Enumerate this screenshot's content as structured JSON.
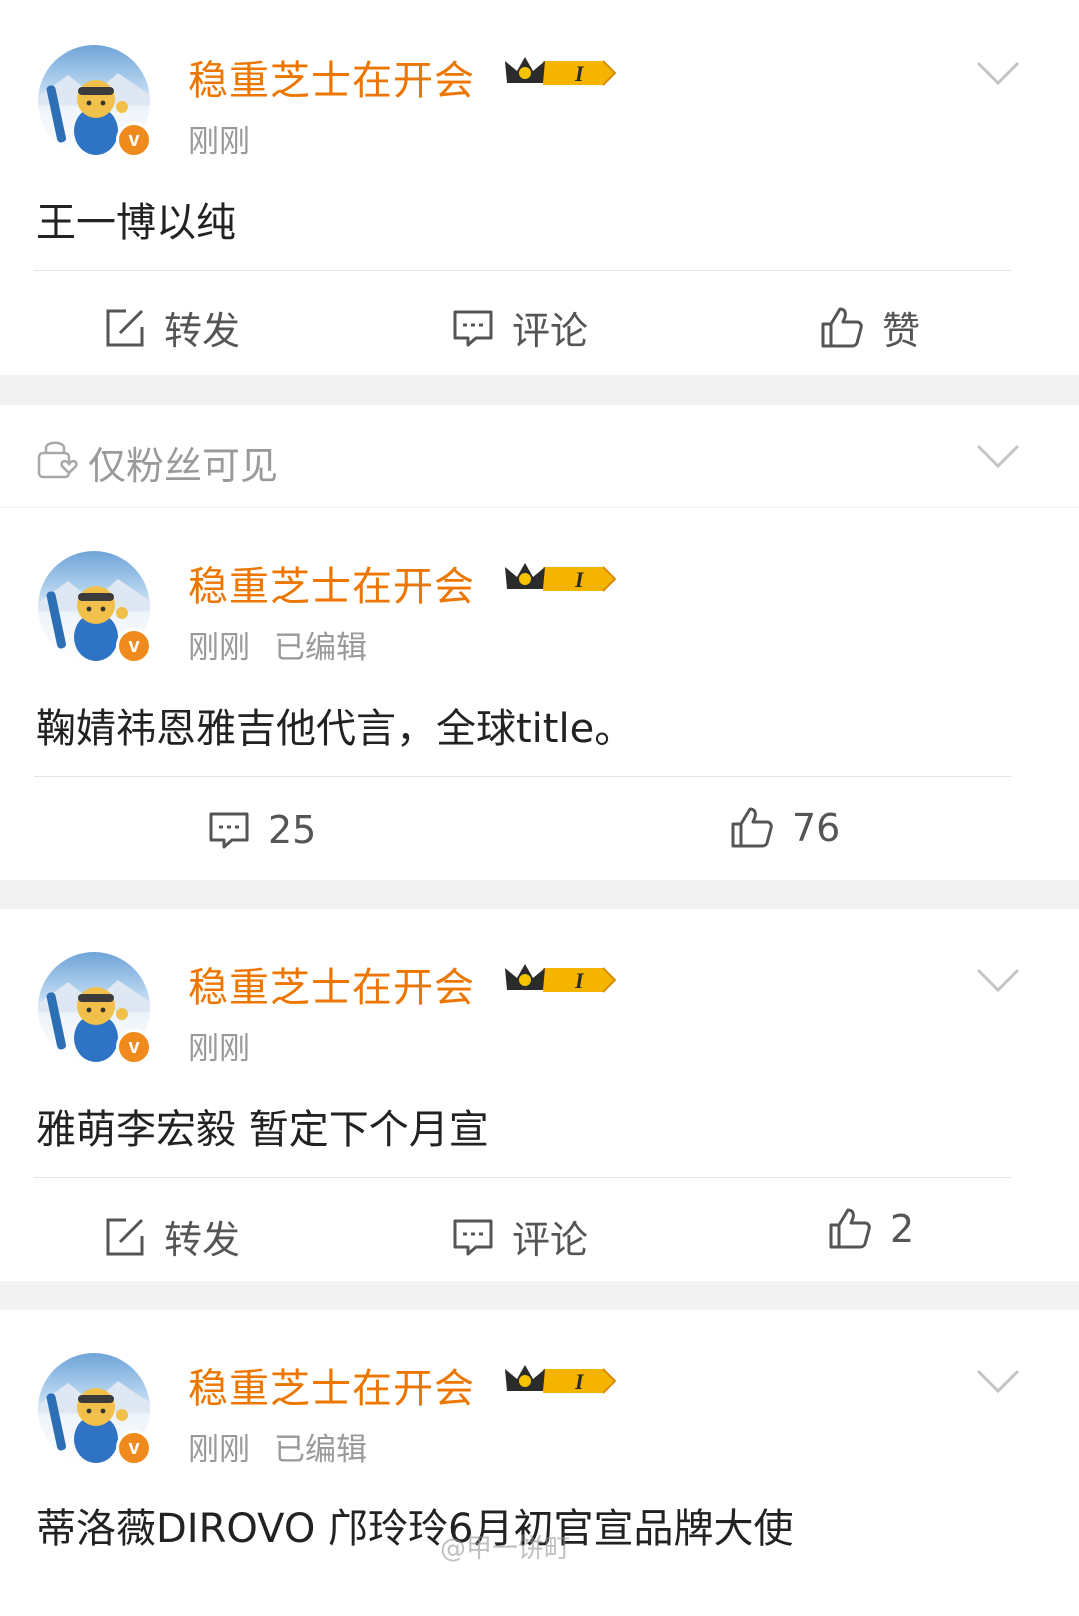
{
  "posts": [
    {
      "username": "稳重芝士在开会",
      "vip_level": "I",
      "time": "刚刚",
      "edited": "",
      "text": "王一博以纯",
      "actions": {
        "repost": "转发",
        "comment": "评论",
        "like": "赞"
      }
    },
    {
      "username": "稳重芝士在开会",
      "vip_level": "I",
      "time": "刚刚",
      "edited": "已编辑",
      "text": "鞠婧祎恩雅吉他代言，全球title。",
      "actions": {
        "comment": "25",
        "like": "76"
      }
    },
    {
      "username": "稳重芝士在开会",
      "vip_level": "I",
      "time": "刚刚",
      "edited": "",
      "text": "雅萌李宏毅 暂定下个月宣",
      "actions": {
        "repost": "转发",
        "comment": "评论",
        "like": "2"
      }
    },
    {
      "username": "稳重芝士在开会",
      "vip_level": "I",
      "time": "刚刚",
      "edited": "已编辑",
      "text": "蒂洛薇DIROVO 邝玲玲6月初官宣品牌大使",
      "actions": {}
    }
  ],
  "fans_only": {
    "label": "仅粉丝可见",
    "icon": "lock-heart-icon"
  },
  "verified_badge": "v",
  "watermark": "@甲一饼町",
  "colors": {
    "username": "#ec7600",
    "badge": "#f08a1c",
    "vip_gold": "#f5b400"
  }
}
